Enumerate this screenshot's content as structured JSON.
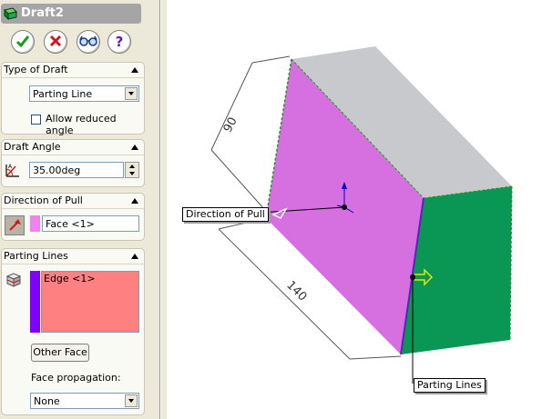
{
  "window": {
    "title": "Draft2"
  },
  "actions": {
    "ok": "ok-checkmark",
    "cancel": "cancel-x",
    "preview": "preview-glasses",
    "help": "help-question"
  },
  "type_of_draft": {
    "header": "Type of Draft",
    "selected": "Parting Line",
    "allow_reduced_label": "Allow reduced angle",
    "allow_reduced_checked": false
  },
  "draft_angle": {
    "header": "Draft Angle",
    "value": "35.00deg"
  },
  "direction_of_pull": {
    "header": "Direction of Pull",
    "value": "Face <1>",
    "swatch_color": "#ee82ee"
  },
  "parting_lines": {
    "header": "Parting Lines",
    "list_item": "Edge <1>",
    "list_color": "#ff8080",
    "marker_color": "#8000ff",
    "other_face_label": "Other Face",
    "face_propagation_label": "Face propagation:",
    "face_propagation_value": "None"
  },
  "viewport": {
    "dimension_width": "90",
    "dimension_length": "140",
    "callout_pull": "Direction of Pull",
    "callout_parting": "Parting Lines",
    "face_colors": {
      "front": "#d670e0",
      "top": "#c8c9cc",
      "side": "#0a9655"
    }
  }
}
